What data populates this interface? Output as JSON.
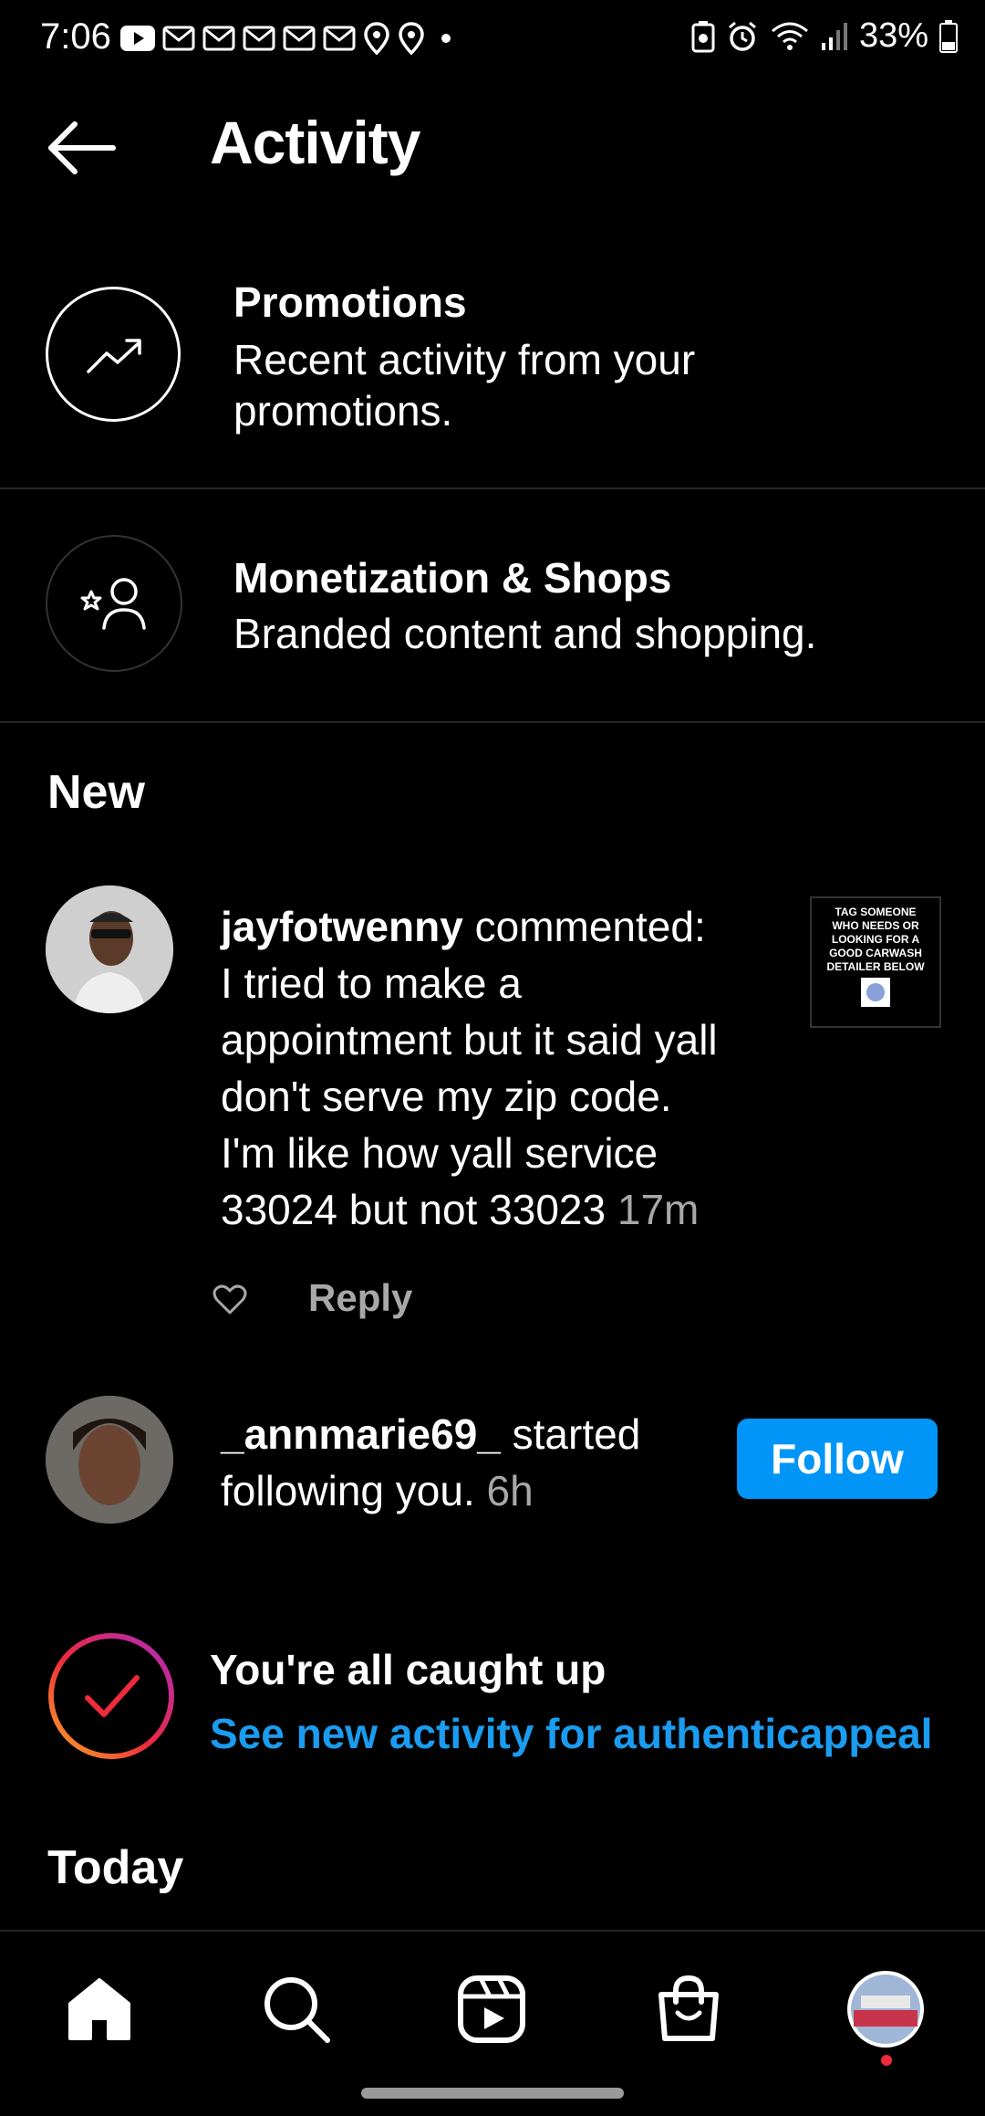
{
  "status_bar": {
    "time": "7:06",
    "battery": "33%",
    "left_icons": [
      "youtube-icon",
      "gmail-icon",
      "gmail-icon",
      "gmail-icon",
      "gmail-icon",
      "gmail-icon",
      "location-icon",
      "location-icon",
      "dot-icon"
    ],
    "right_icons": [
      "battery-saver-icon",
      "alarm-icon",
      "wifi-icon",
      "signal-icon",
      "battery-icon"
    ]
  },
  "header": {
    "title": "Activity"
  },
  "promotions": {
    "title": "Promotions",
    "subtitle_line1": "Recent activity from your",
    "subtitle_line2": "promotions."
  },
  "monetization": {
    "title": "Monetization & Shops",
    "subtitle": "Branded content and shopping."
  },
  "section_new": "New",
  "notifications": [
    {
      "username": "jayfotwenny",
      "action": " commented:",
      "lines": [
        "I tried to make a",
        "appointment but it said yall",
        "don't serve my zip code.",
        "I'm like how yall service"
      ],
      "last_line": "33024 but not 33023",
      "time": "17m",
      "reply_label": "Reply",
      "thumbnail_text": "TAG SOMEONE WHO NEEDS OR LOOKING FOR A GOOD CARWASH DETAILER BELOW"
    },
    {
      "username": "_annmarie69_",
      "action": " started",
      "line2": "following you.",
      "time": "6h",
      "button_label": "Follow"
    }
  ],
  "caught_up": {
    "title": "You're all caught up",
    "link": "See new activity for authenticappeal"
  },
  "section_today": "Today",
  "colors": {
    "background": "#000000",
    "accent_blue": "#0095f6",
    "link_blue": "#1a9cf0",
    "muted": "#a8a8a8",
    "divider": "#262626"
  }
}
